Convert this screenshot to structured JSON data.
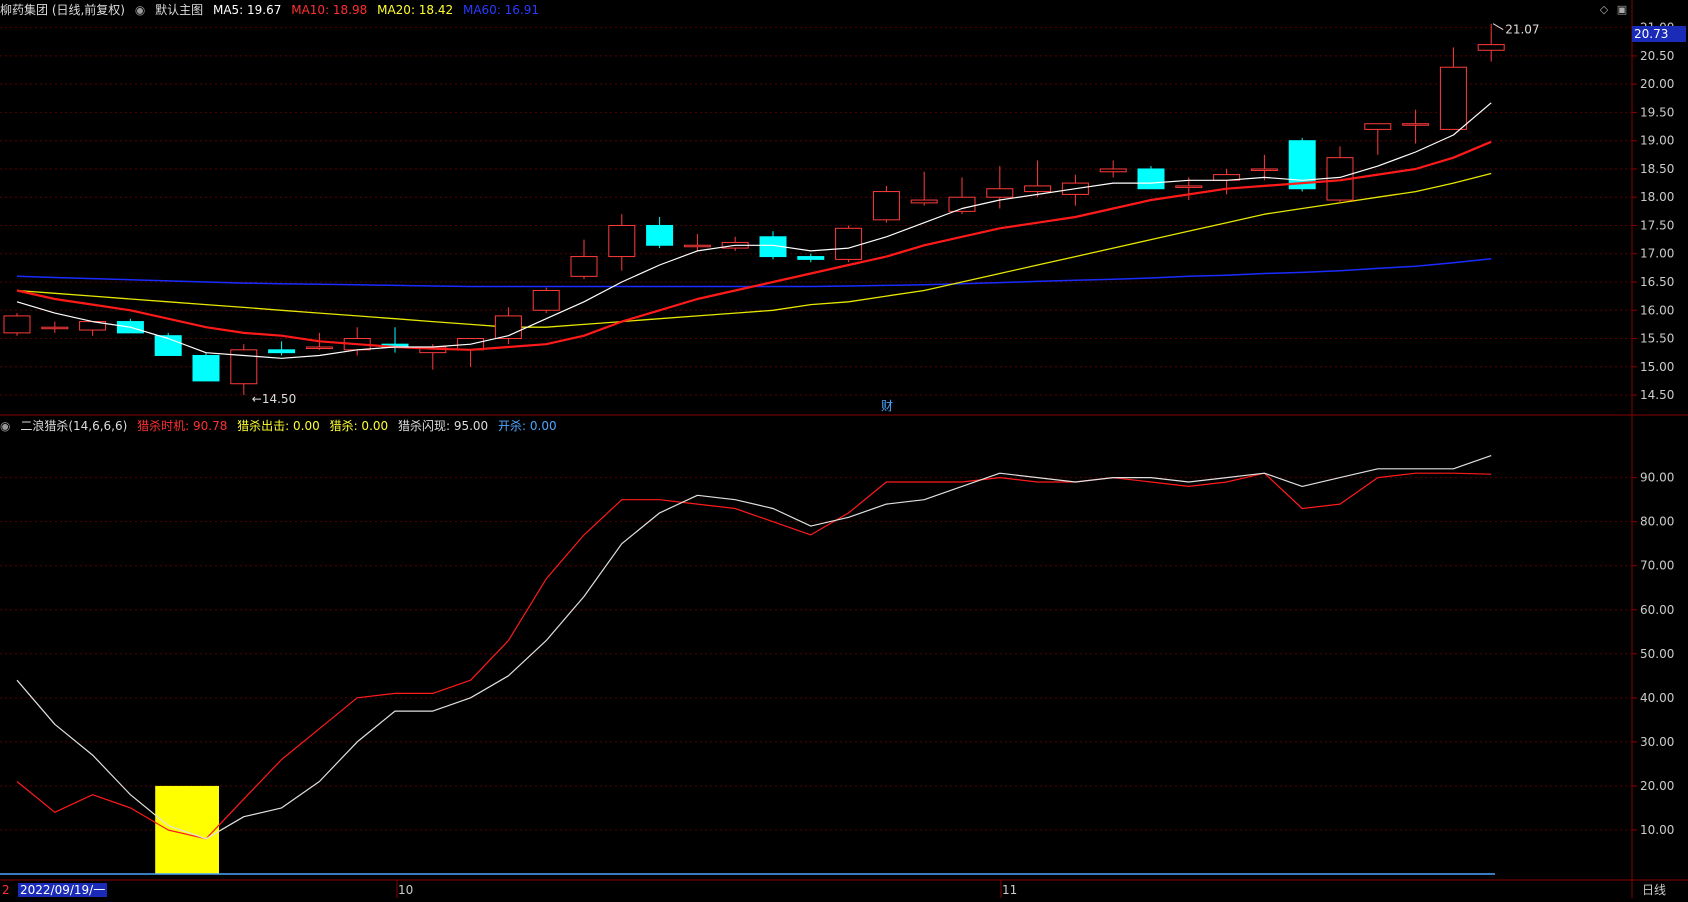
{
  "header": {
    "stock": "柳药集团 (日线,前复权)",
    "main_chart_label": "默认主图",
    "ma5": "MA5: 19.67",
    "ma10": "MA10: 18.98",
    "ma20": "MA20: 18.42",
    "ma60": "MA60: 16.91",
    "current_price": "20.73"
  },
  "indicator_header": {
    "name": "二浪猎杀(14,6,6,6)",
    "timing": "猎杀时机: 90.78",
    "exit": "猎杀出击: 0.00",
    "kill": "猎杀: 0.00",
    "flash": "猎杀闪现: 95.00",
    "open": "开杀: 0.00"
  },
  "bottom": {
    "date": "2022/09/19/一",
    "month_10": "10",
    "month_11": "11",
    "tab": "日线",
    "left_tick": "2"
  },
  "colors": {
    "up": "#ff3b3b",
    "down": "#00ffff",
    "ma5": "#ffffff",
    "ma10": "#ff1a1a",
    "ma20": "#e6e600",
    "ma60": "#1a2bff",
    "grid": "#5a0000",
    "highlight": "#ffff00"
  },
  "chart_data": [
    {
      "type": "candlestick",
      "ylim": [
        14.2,
        21.1
      ],
      "yticks": [
        "21.00",
        "20.50",
        "20.00",
        "19.50",
        "19.00",
        "18.50",
        "18.00",
        "17.50",
        "17.00",
        "16.50",
        "16.00",
        "15.50",
        "15.00",
        "14.50"
      ],
      "annotations": {
        "high": "21.07",
        "low": "14.50",
        "event": "财"
      },
      "candles": [
        {
          "o": 15.6,
          "h": 15.95,
          "l": 15.55,
          "c": 15.9
        },
        {
          "o": 15.7,
          "h": 15.8,
          "l": 15.6,
          "c": 15.7
        },
        {
          "o": 15.65,
          "h": 15.8,
          "l": 15.55,
          "c": 15.8
        },
        {
          "o": 15.8,
          "h": 15.85,
          "l": 15.6,
          "c": 15.6
        },
        {
          "o": 15.55,
          "h": 15.6,
          "l": 15.2,
          "c": 15.2
        },
        {
          "o": 15.2,
          "h": 15.25,
          "l": 14.75,
          "c": 14.75
        },
        {
          "o": 14.7,
          "h": 15.4,
          "l": 14.5,
          "c": 15.3
        },
        {
          "o": 15.3,
          "h": 15.45,
          "l": 15.2,
          "c": 15.25
        },
        {
          "o": 15.35,
          "h": 15.6,
          "l": 15.3,
          "c": 15.35
        },
        {
          "o": 15.3,
          "h": 15.7,
          "l": 15.2,
          "c": 15.5
        },
        {
          "o": 15.4,
          "h": 15.7,
          "l": 15.25,
          "c": 15.35
        },
        {
          "o": 15.25,
          "h": 15.4,
          "l": 14.95,
          "c": 15.35
        },
        {
          "o": 15.3,
          "h": 15.5,
          "l": 15.0,
          "c": 15.5
        },
        {
          "o": 15.5,
          "h": 16.05,
          "l": 15.4,
          "c": 15.9
        },
        {
          "o": 16.0,
          "h": 16.4,
          "l": 15.95,
          "c": 16.35
        },
        {
          "o": 16.6,
          "h": 17.25,
          "l": 16.55,
          "c": 16.95
        },
        {
          "o": 16.95,
          "h": 17.7,
          "l": 16.7,
          "c": 17.5
        },
        {
          "o": 17.5,
          "h": 17.65,
          "l": 17.1,
          "c": 17.15
        },
        {
          "o": 17.15,
          "h": 17.35,
          "l": 17.05,
          "c": 17.15
        },
        {
          "o": 17.1,
          "h": 17.3,
          "l": 17.05,
          "c": 17.2
        },
        {
          "o": 17.3,
          "h": 17.4,
          "l": 16.9,
          "c": 16.95
        },
        {
          "o": 16.95,
          "h": 17.0,
          "l": 16.85,
          "c": 16.9
        },
        {
          "o": 16.9,
          "h": 17.5,
          "l": 16.85,
          "c": 17.45
        },
        {
          "o": 17.6,
          "h": 18.2,
          "l": 17.55,
          "c": 18.1
        },
        {
          "o": 17.9,
          "h": 18.45,
          "l": 17.85,
          "c": 17.95
        },
        {
          "o": 17.75,
          "h": 18.35,
          "l": 17.7,
          "c": 18.0
        },
        {
          "o": 18.0,
          "h": 18.55,
          "l": 17.8,
          "c": 18.15
        },
        {
          "o": 18.1,
          "h": 18.65,
          "l": 18.0,
          "c": 18.2
        },
        {
          "o": 18.05,
          "h": 18.4,
          "l": 17.85,
          "c": 18.25
        },
        {
          "o": 18.45,
          "h": 18.65,
          "l": 18.35,
          "c": 18.5
        },
        {
          "o": 18.5,
          "h": 18.55,
          "l": 18.15,
          "c": 18.15
        },
        {
          "o": 18.2,
          "h": 18.35,
          "l": 17.95,
          "c": 18.2
        },
        {
          "o": 18.3,
          "h": 18.5,
          "l": 18.05,
          "c": 18.4
        },
        {
          "o": 18.5,
          "h": 18.75,
          "l": 18.3,
          "c": 18.5
        },
        {
          "o": 19.0,
          "h": 19.05,
          "l": 18.1,
          "c": 18.15
        },
        {
          "o": 17.95,
          "h": 18.9,
          "l": 17.9,
          "c": 18.7
        },
        {
          "o": 19.2,
          "h": 19.3,
          "l": 18.75,
          "c": 19.3
        },
        {
          "o": 19.3,
          "h": 19.55,
          "l": 18.95,
          "c": 19.3
        },
        {
          "o": 19.2,
          "h": 20.65,
          "l": 19.2,
          "c": 20.3
        },
        {
          "o": 20.6,
          "h": 21.07,
          "l": 20.4,
          "c": 20.7
        }
      ],
      "ma5": [
        16.15,
        15.95,
        15.8,
        15.7,
        15.5,
        15.25,
        15.2,
        15.15,
        15.2,
        15.3,
        15.35,
        15.35,
        15.4,
        15.55,
        15.85,
        16.15,
        16.5,
        16.8,
        17.05,
        17.15,
        17.15,
        17.05,
        17.1,
        17.3,
        17.55,
        17.8,
        17.95,
        18.05,
        18.15,
        18.25,
        18.25,
        18.3,
        18.3,
        18.35,
        18.3,
        18.35,
        18.55,
        18.8,
        19.1,
        19.67
      ],
      "ma10": [
        16.35,
        16.2,
        16.1,
        16.0,
        15.85,
        15.7,
        15.6,
        15.55,
        15.45,
        15.4,
        15.35,
        15.32,
        15.3,
        15.35,
        15.4,
        15.55,
        15.8,
        16.0,
        16.2,
        16.35,
        16.5,
        16.65,
        16.8,
        16.95,
        17.15,
        17.3,
        17.45,
        17.55,
        17.65,
        17.8,
        17.95,
        18.05,
        18.15,
        18.2,
        18.25,
        18.3,
        18.4,
        18.5,
        18.7,
        18.98
      ],
      "ma20": [
        16.35,
        16.3,
        16.25,
        16.2,
        16.15,
        16.1,
        16.05,
        16.0,
        15.95,
        15.9,
        15.85,
        15.8,
        15.75,
        15.7,
        15.7,
        15.75,
        15.8,
        15.85,
        15.9,
        15.95,
        16.0,
        16.1,
        16.15,
        16.25,
        16.35,
        16.5,
        16.65,
        16.8,
        16.95,
        17.1,
        17.25,
        17.4,
        17.55,
        17.7,
        17.8,
        17.9,
        18.0,
        18.1,
        18.25,
        18.42
      ],
      "ma60": [
        16.6,
        16.58,
        16.56,
        16.54,
        16.52,
        16.5,
        16.48,
        16.47,
        16.46,
        16.45,
        16.44,
        16.43,
        16.42,
        16.42,
        16.42,
        16.42,
        16.42,
        16.42,
        16.42,
        16.42,
        16.42,
        16.42,
        16.43,
        16.44,
        16.45,
        16.47,
        16.49,
        16.51,
        16.53,
        16.55,
        16.57,
        16.6,
        16.62,
        16.65,
        16.67,
        16.7,
        16.74,
        16.78,
        16.84,
        16.91
      ]
    },
    {
      "type": "line",
      "ylim": [
        0,
        99
      ],
      "yticks": [
        "90.00",
        "80.00",
        "70.00",
        "60.00",
        "50.00",
        "40.00",
        "30.00",
        "20.00",
        "10.00"
      ],
      "series": [
        {
          "name": "猎杀时机",
          "values": [
            21,
            14,
            18,
            15,
            10,
            8,
            17,
            26,
            33,
            40,
            41,
            41,
            44,
            53,
            67,
            77,
            85,
            85,
            84,
            83,
            80,
            77,
            82,
            89,
            89,
            89,
            90,
            89,
            89,
            90,
            89,
            88,
            89,
            91,
            83,
            84,
            90,
            91,
            91,
            90.78
          ]
        },
        {
          "name": "猎杀闪现",
          "values": [
            44,
            34,
            27,
            18,
            11,
            8,
            13,
            15,
            21,
            30,
            37,
            37,
            40,
            45,
            53,
            63,
            75,
            82,
            86,
            85,
            83,
            79,
            81,
            84,
            85,
            88,
            91,
            90,
            89,
            90,
            90,
            89,
            90,
            91,
            88,
            90,
            92,
            92,
            92,
            95
          ]
        }
      ],
      "highlight_bars": [
        {
          "from": 4,
          "to": 5,
          "value": 20
        }
      ]
    }
  ]
}
